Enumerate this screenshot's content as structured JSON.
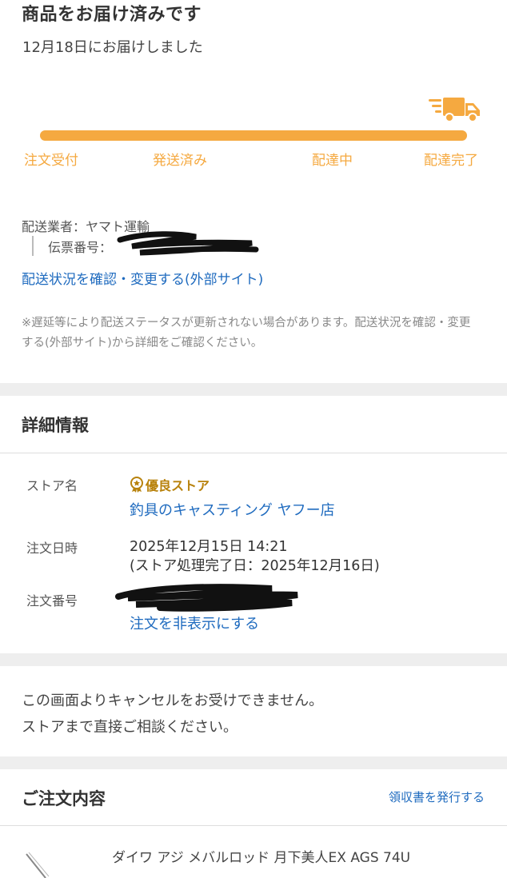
{
  "colors": {
    "accent": "#f5a940",
    "link": "#1f6bbf",
    "badge": "#b8820c"
  },
  "status": {
    "title": "商品をお届け済みです",
    "delivered_date": "12月18日にお届けしました",
    "truck_icon": "delivery-truck-icon",
    "progress": 1.0,
    "steps": [
      "注文受付",
      "発送済み",
      "配達中",
      "配達完了"
    ]
  },
  "shipping": {
    "carrier": "配送業者：ヤマト運輸",
    "slip_label": "伝票番号：",
    "track_link": "配送状況を確認・変更する(外部サイト)",
    "note": "※遅延等により配送ステータスが更新されない場合があります。配送状況を確認・変更する(外部サイト)から詳細をご確認ください。"
  },
  "details": {
    "title": "詳細情報",
    "store_label": "ストア名",
    "badge": "優良ストア",
    "store_name": "釣具のキャスティング ヤフー店",
    "date_label": "注文日時",
    "order_datetime": "2025年12月15日 14:21",
    "process_date": "(ストア処理完了日：2025年12月16日)",
    "number_label": "注文番号",
    "hide_link": "注文を非表示にする"
  },
  "cancel_notice": [
    "この画面よりキャンセルをお受けできません。",
    "ストアまで直接ご相談ください。"
  ],
  "order": {
    "title": "ご注文内容",
    "receipt_link": "領収書を発行する",
    "product_name": "ダイワ アジ メバルロッド 月下美人EX AGS 74U"
  }
}
